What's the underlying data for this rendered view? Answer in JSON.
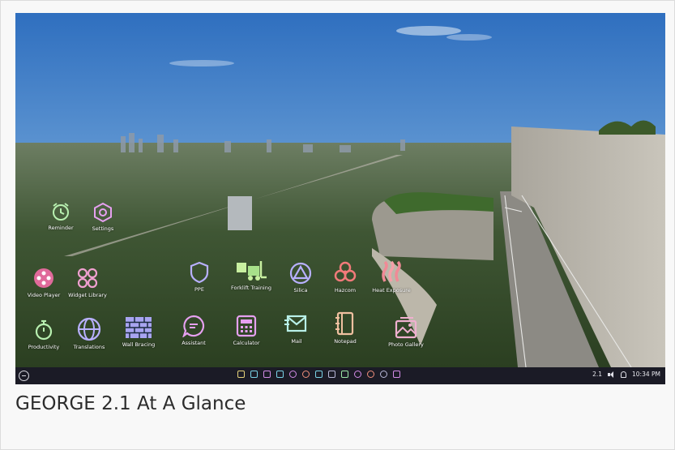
{
  "caption": "GEORGE 2.1 At A Glance",
  "desktop": {
    "apps": [
      {
        "label": "Reminder",
        "icon": "clock-reminder-icon"
      },
      {
        "label": "Settings",
        "icon": "gear-hex-icon"
      },
      {
        "label": "Video Player",
        "icon": "film-reel-icon"
      },
      {
        "label": "Widget Library",
        "icon": "widget-grid-icon"
      },
      {
        "label": "PPE",
        "icon": "shield-icon"
      },
      {
        "label": "Forklift Training",
        "icon": "forklift-icon"
      },
      {
        "label": "Silica",
        "icon": "triangle-circle-icon"
      },
      {
        "label": "Hazcom",
        "icon": "biohazard-icon"
      },
      {
        "label": "Heat Exposure",
        "icon": "heat-icon"
      },
      {
        "label": "Productivity",
        "icon": "stopwatch-icon"
      },
      {
        "label": "Translations",
        "icon": "globe-icon"
      },
      {
        "label": "Wall Bracing",
        "icon": "brick-wall-icon"
      },
      {
        "label": "Assistant",
        "icon": "chat-bubble-icon"
      },
      {
        "label": "Calculator",
        "icon": "calculator-icon"
      },
      {
        "label": "Mail",
        "icon": "mail-icon"
      },
      {
        "label": "Notepad",
        "icon": "notepad-icon"
      },
      {
        "label": "Photo Gallery",
        "icon": "photo-gallery-icon"
      }
    ]
  },
  "taskbar": {
    "version": "2.1",
    "clock": "10:34 PM",
    "pinned_icons": [
      "calculator-icon",
      "terminal-icon",
      "video-icon",
      "mail-icon",
      "chat-icon",
      "clock-icon",
      "notepad-icon",
      "gallery-icon",
      "reminder-icon",
      "settings-icon",
      "film-icon",
      "globe-icon",
      "widgets-icon"
    ]
  },
  "colors": {
    "taskbar_bg": "#1b1b26",
    "icon_accent": "#a9a2ff"
  }
}
